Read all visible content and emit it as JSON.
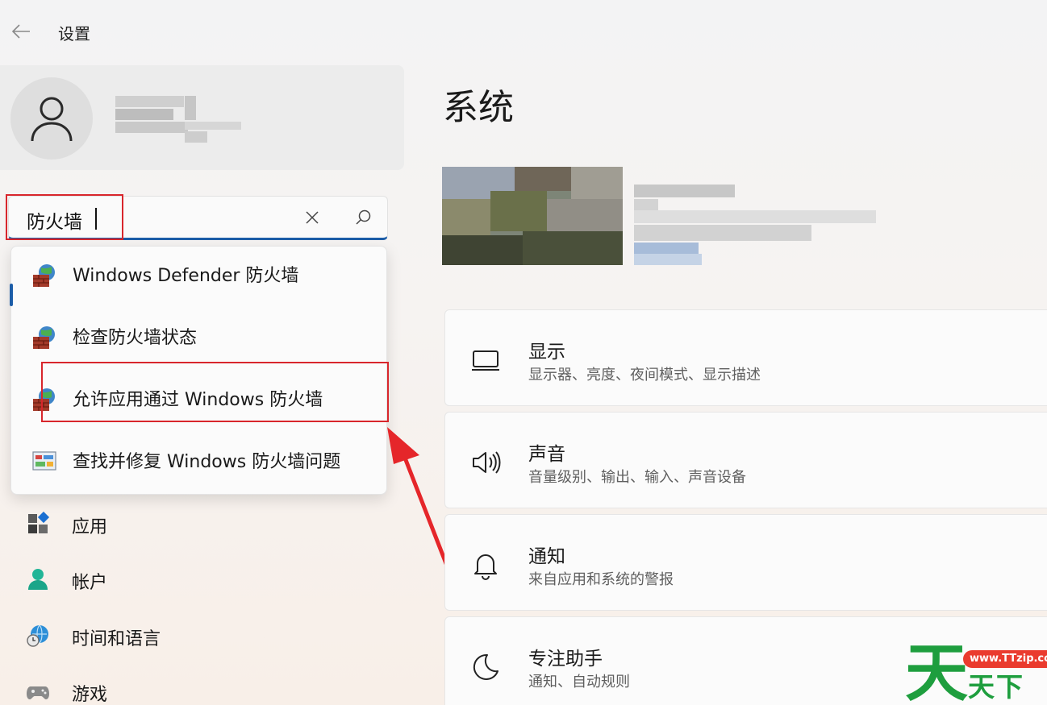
{
  "titlebar": {
    "title": "设置",
    "back_icon": "back-arrow-icon"
  },
  "profile": {
    "avatar_icon": "person-icon"
  },
  "search": {
    "value": "防火墙"
  },
  "suggestions": [
    {
      "label": "Windows Defender 防火墙",
      "icon": "firewall-icon"
    },
    {
      "label": "检查防火墙状态",
      "icon": "firewall-icon"
    },
    {
      "label": "允许应用通过 Windows 防火墙",
      "icon": "firewall-icon"
    },
    {
      "label": "查找并修复 Windows 防火墙问题",
      "icon": "troubleshoot-icon"
    }
  ],
  "nav": [
    {
      "label": "应用",
      "icon": "apps-icon"
    },
    {
      "label": "帐户",
      "icon": "account-icon"
    },
    {
      "label": "时间和语言",
      "icon": "time-language-icon"
    },
    {
      "label": "游戏",
      "icon": "gaming-icon"
    }
  ],
  "main": {
    "title": "系统",
    "cards": [
      {
        "title": "显示",
        "subtitle": "显示器、亮度、夜间模式、显示描述",
        "icon": "display-icon"
      },
      {
        "title": "声音",
        "subtitle": "音量级别、输出、输入、声音设备",
        "icon": "speaker-icon"
      },
      {
        "title": "通知",
        "subtitle": "来自应用和系统的警报",
        "icon": "bell-icon"
      },
      {
        "title": "专注助手",
        "subtitle": "通知、自动规则",
        "icon": "moon-icon"
      }
    ]
  },
  "watermark": {
    "big": "天",
    "url": "www.TTzip.com",
    "text": "天下載"
  },
  "colors": {
    "accent": "#1c5da8",
    "annotation": "#d8262c",
    "watermark_green": "#1e9e3e"
  }
}
